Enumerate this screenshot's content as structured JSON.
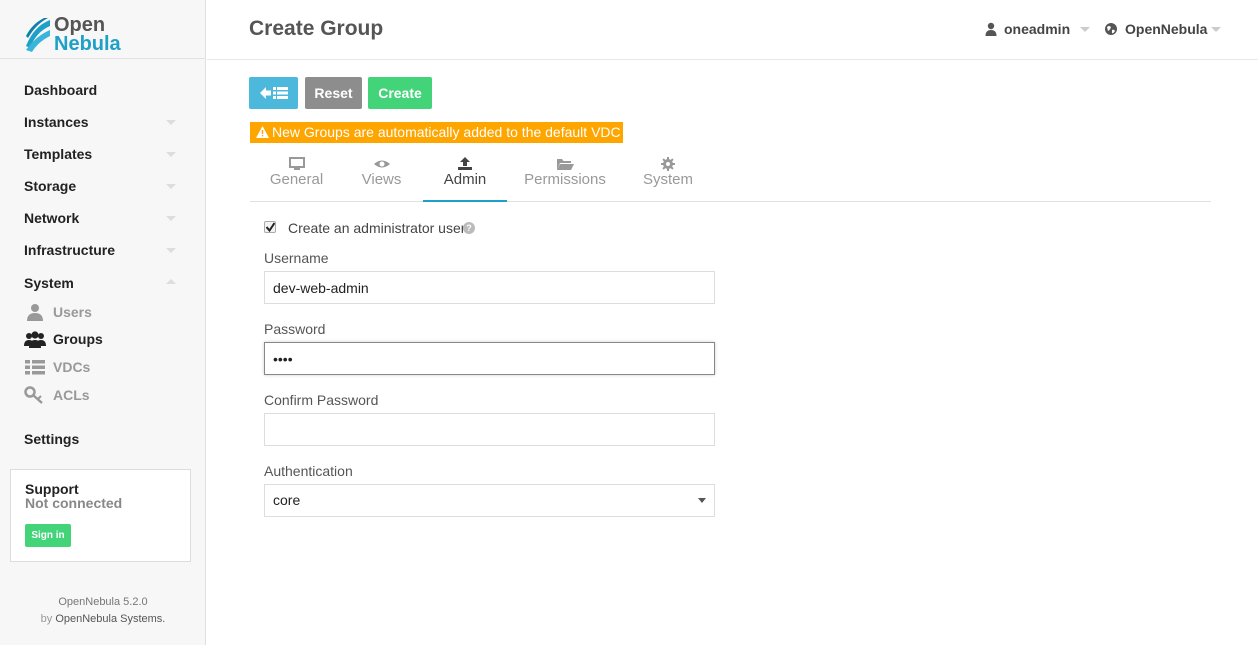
{
  "brand": {
    "logo_line1": "Open",
    "logo_line2": "Nebula"
  },
  "sidebar": {
    "items": [
      {
        "label": "Dashboard"
      },
      {
        "label": "Instances"
      },
      {
        "label": "Templates"
      },
      {
        "label": "Storage"
      },
      {
        "label": "Network"
      },
      {
        "label": "Infrastructure"
      },
      {
        "label": "System"
      }
    ],
    "system_sub": [
      {
        "label": "Users",
        "icon": "user-icon"
      },
      {
        "label": "Groups",
        "icon": "users-icon"
      },
      {
        "label": "VDCs",
        "icon": "list-icon"
      },
      {
        "label": "ACLs",
        "icon": "key-icon"
      }
    ],
    "settings_label": "Settings",
    "support": {
      "title": "Support",
      "status": "Not connected",
      "signin_label": "Sign in"
    },
    "footer": {
      "version": "OpenNebula 5.2.0",
      "by_prefix": "by",
      "by_company": "OpenNebula Systems."
    }
  },
  "header": {
    "title": "Create Group",
    "user": "oneadmin",
    "zone": "OpenNebula"
  },
  "toolbar": {
    "reset_label": "Reset",
    "create_label": "Create"
  },
  "warning": "New Groups are automatically added to the default VDC",
  "tabs": [
    {
      "label": "General",
      "icon": "monitor-icon"
    },
    {
      "label": "Views",
      "icon": "eye-icon"
    },
    {
      "label": "Admin",
      "icon": "upload-icon"
    },
    {
      "label": "Permissions",
      "icon": "folder-open-icon"
    },
    {
      "label": "System",
      "icon": "gear-icon"
    }
  ],
  "active_tab": "Admin",
  "form": {
    "create_admin_label": "Create an administrator user",
    "create_admin_checked": true,
    "username_label": "Username",
    "username_value": "dev-web-admin",
    "password_label": "Password",
    "password_value": "abcd",
    "confirm_password_label": "Confirm Password",
    "confirm_password_value": "",
    "auth_label": "Authentication",
    "auth_value": "core"
  },
  "colors": {
    "accent": "#1ea0c8",
    "create_green": "#43d47a",
    "back_blue": "#4cb9dc",
    "warning_orange": "#ffa500",
    "reset_grey": "#8d8d8d"
  }
}
